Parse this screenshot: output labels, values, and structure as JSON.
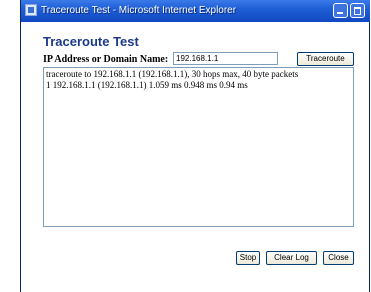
{
  "window": {
    "title": "Traceroute Test - Microsoft Internet Explorer"
  },
  "page": {
    "title": "Traceroute Test"
  },
  "form": {
    "address_label": "IP Address or Domain Name:",
    "address_value": "192.168.1.1",
    "traceroute_button": "Traceroute"
  },
  "log": {
    "lines": [
      "traceroute to 192.168.1.1 (192.168.1.1), 30 hops max, 40 byte packets",
      "1 192.168.1.1 (192.168.1.1) 1.059 ms 0.948 ms 0.94 ms"
    ]
  },
  "actions": {
    "stop": "Stop",
    "clear_log": "Clear Log",
    "close": "Close"
  },
  "icons": [
    "ie-app-icon",
    "minimize-icon",
    "maximize-icon"
  ],
  "colors": {
    "titlebar": "#1f5fd6",
    "page_title": "#1d3a8a",
    "input_border": "#7f9db9"
  }
}
